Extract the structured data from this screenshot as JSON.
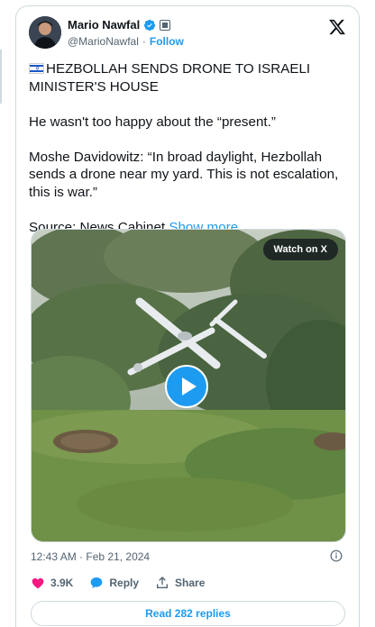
{
  "author": {
    "name": "Mario Nawfal",
    "handle": "@MarioNawfal",
    "separator": "·",
    "follow_label": "Follow"
  },
  "tweet": {
    "headline": "HEZBOLLAH SENDS DRONE TO ISRAELI MINISTER'S HOUSE",
    "line2": "He wasn't too happy about the “present.”",
    "line3": "Moshe Davidowitz: “In broad daylight, Hezbollah sends a drone near my yard. This is not escalation, this is war.”",
    "source_label": "Source: News Cabinet",
    "show_more": "Show more"
  },
  "media": {
    "watch_label": "Watch on X"
  },
  "meta": {
    "timestamp": "12:43 AM · Feb 21, 2024"
  },
  "actions": {
    "likes": "3.9K",
    "reply_label": "Reply",
    "share_label": "Share"
  },
  "footer": {
    "read_replies": "Read 282 replies"
  },
  "colors": {
    "accent": "#1d9bf0",
    "like": "#f91880",
    "text": "#0f1419",
    "muted": "#536471"
  }
}
